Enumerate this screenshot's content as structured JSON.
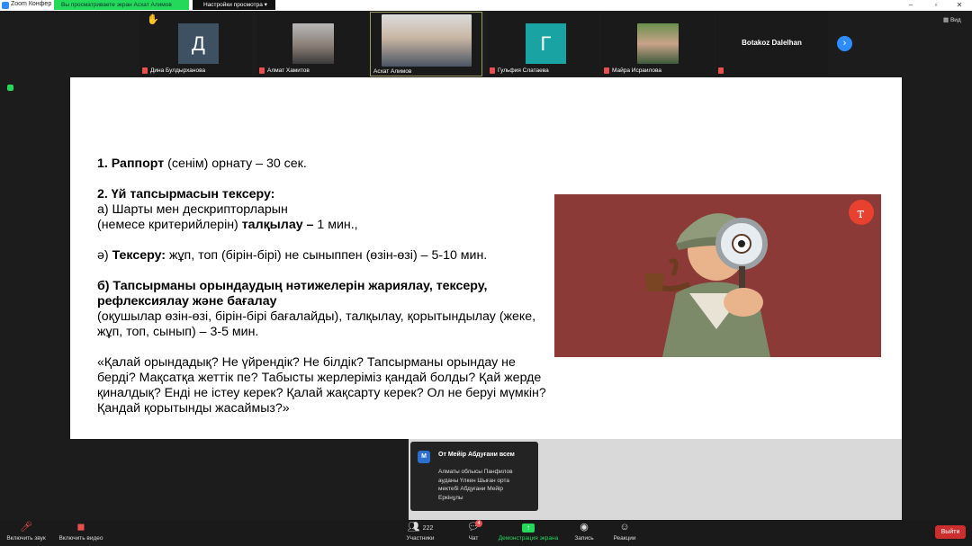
{
  "window": {
    "title": "Zoom Конфер",
    "share_banner": "Вы просматриваете экран Асхат Алимов",
    "view_options": "Настройки просмотра",
    "view_label": "Вид"
  },
  "gallery": {
    "participants": [
      {
        "name": "Дина Булдырханова",
        "initial": "Д",
        "color": "#3d5163"
      },
      {
        "name": "Алмат Хамитов"
      },
      {
        "name": "Асхат Алимов"
      },
      {
        "name": "Гульфия Слатаева",
        "initial": "Г",
        "color": "#1aa3a3"
      },
      {
        "name": "Майра Исраилова"
      },
      {
        "name": "Botakoz Dalelhan"
      }
    ]
  },
  "slide": {
    "p1_bold": "1. Раппорт",
    "p1_rest": " (сенім) орнату – 30 сек.",
    "p2_title": "2. Үй тапсырмасын тексеру:",
    "p2_line1": "а) Шарты мен дескрипторларын",
    "p2_line2a": "(немесе критерийлерін) ",
    "p2_line2b": "талқылау –",
    "p2_line2c": " 1 мин.,",
    "p3_a": "ә) ",
    "p3_bold": "Тексеру:",
    "p3_rest": " жұп, топ (бірін-бірі) не сыныппен (өзін-өзі) – 5-10 мин.",
    "p4_bold": "б) Тапсырманы орындаудың нәтижелерін жариялау, тексеру, рефлексиялау және бағалау",
    "p4_rest": "(оқушылар өзін-өзі, бірін-бірі бағалайды), талқылау, қорытындылау (жеке, жұп, топ, сынып) – 3-5 мин.",
    "p5": "«Қалай орындадық? Не үйрендік? Не білдік? Тапсырманы орындау не берді? Мақсатқа жеттік пе? Табысты жерлеріміз қандай болды? Қай жерде қиналдық? Енді не істеу керек? Қалай жақсарту керек? Ол не беруі мүмкін? Қандай қорытынды жасаймыз?»",
    "image_bg": "#8c3a38"
  },
  "notification": {
    "avatar_letter": "М",
    "header": "От Мейір Абдуғани всем",
    "message": "Алматы облысы Панфилов ауданы Үлкен Шыған орта мектебі Абдуғани Мейір Еркінұлы"
  },
  "toolbar": {
    "audio": "Включить звук",
    "video": "Включить видео",
    "participants": "Участники",
    "participants_count": "222",
    "chat": "Чат",
    "chat_badge": "4",
    "share": "Демонстрация экрана",
    "record": "Запись",
    "reactions": "Реакции",
    "leave": "Выйти"
  }
}
